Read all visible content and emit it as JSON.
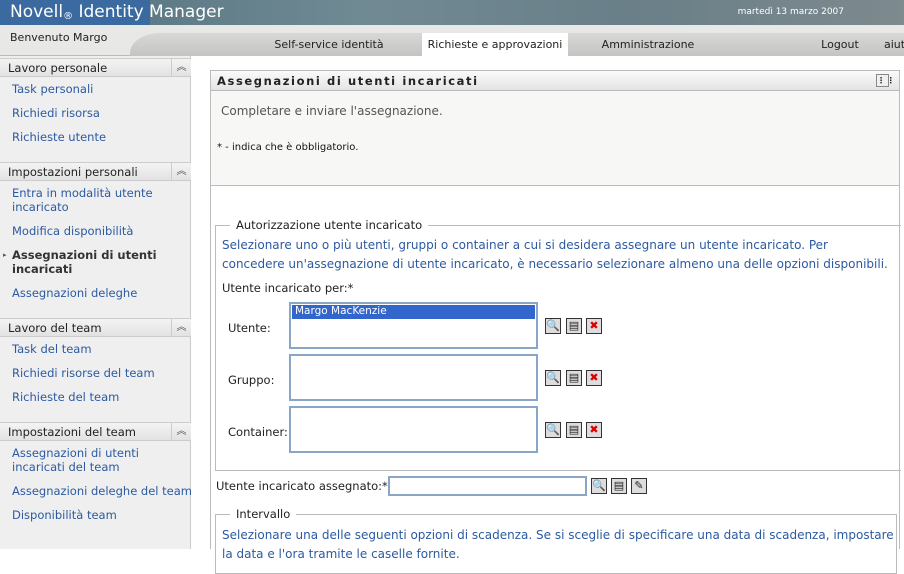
{
  "header": {
    "brand": "Novell",
    "brand_mark": "®",
    "product": " Identity Manager",
    "date": "martedì 13 marzo 2007"
  },
  "nav": {
    "welcome": "Benvenuto Margo",
    "tabs": [
      {
        "label": "Self-service identità"
      },
      {
        "label": "Richieste e approvazioni"
      },
      {
        "label": "Amministrazione"
      }
    ],
    "logout": "Logout",
    "help": "aiuto"
  },
  "sidebar": {
    "sections": [
      {
        "title": "Lavoro personale",
        "items": [
          "Task personali",
          "Richiedi risorsa",
          "Richieste utente"
        ]
      },
      {
        "title": "Impostazioni personali",
        "items": [
          "Entra in modalità utente incaricato",
          "Modifica disponibilità",
          "Assegnazioni di utenti incaricati",
          "Assegnazioni deleghe"
        ]
      },
      {
        "title": "Lavoro del team",
        "items": [
          "Task del team",
          "Richiedi risorse del team",
          "Richieste del team"
        ]
      },
      {
        "title": "Impostazioni del team",
        "items": [
          "Assegnazioni di utenti incaricati del team",
          "Assegnazioni deleghe del team",
          "Disponibilità team"
        ]
      }
    ]
  },
  "main": {
    "title": "Assegnazioni di utenti incaricati",
    "intro": "Completare e inviare l'assegnazione.",
    "required_note": "* - indica che è obbligatorio.",
    "auth": {
      "legend": "Autorizzazione utente incaricato",
      "desc": "Selezionare uno o più utenti, gruppi o container a cui si desidera assegnare un utente incaricato. Per concedere un'assegnazione di utente incaricato, è necessario selezionare almeno una delle opzioni disponibili.",
      "for_label": "Utente incaricato per:*",
      "rows": [
        {
          "label": "Utente:",
          "value": "Margo MacKenzie"
        },
        {
          "label": "Gruppo:",
          "value": ""
        },
        {
          "label": "Container:",
          "value": ""
        }
      ]
    },
    "assigned_label": "Utente incaricato assegnato:*",
    "assigned_value": "",
    "interval": {
      "legend": "Intervallo",
      "desc": "Selezionare una delle seguenti opzioni di scadenza. Se si sceglie di specificare una data di scadenza, impostare la data e l'ora tramite le caselle fornite."
    }
  }
}
